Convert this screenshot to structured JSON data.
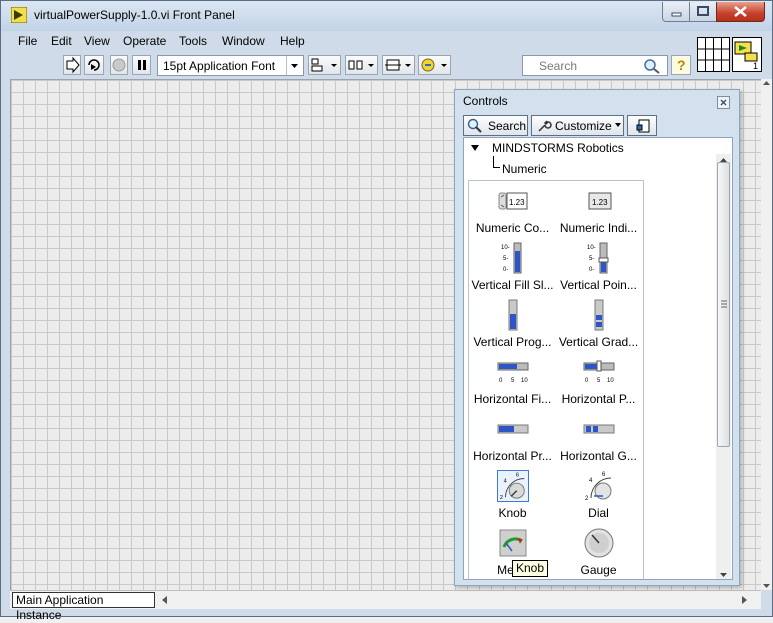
{
  "window": {
    "title": "virtualPowerSupply-1.0.vi Front Panel"
  },
  "menu": [
    "File",
    "Edit",
    "View",
    "Operate",
    "Tools",
    "Window",
    "Help"
  ],
  "toolbar": {
    "font": "15pt Application Font",
    "search_placeholder": "Search",
    "help": "?"
  },
  "status": {
    "instance": "Main Application Instance"
  },
  "palette": {
    "title": "Controls",
    "search_label": "Search",
    "customize_label": "Customize",
    "tree_root": "MINDSTORMS Robotics",
    "tree_child": "Numeric",
    "items": [
      {
        "label": "Numeric Co...",
        "icon": "numeric-control-icon"
      },
      {
        "label": "Numeric Indi...",
        "icon": "numeric-indicator-icon"
      },
      {
        "label": "Vertical Fill Sl...",
        "icon": "vertical-fill-slide-icon"
      },
      {
        "label": "Vertical Poin...",
        "icon": "vertical-pointer-slide-icon"
      },
      {
        "label": "Vertical Prog...",
        "icon": "vertical-progress-bar-icon"
      },
      {
        "label": "Vertical Grad...",
        "icon": "vertical-graduated-bar-icon"
      },
      {
        "label": "Horizontal Fi...",
        "icon": "horizontal-fill-slide-icon"
      },
      {
        "label": "Horizontal P...",
        "icon": "horizontal-pointer-slide-icon"
      },
      {
        "label": "Horizontal Pr...",
        "icon": "horizontal-progress-bar-icon"
      },
      {
        "label": "Horizontal G...",
        "icon": "horizontal-graduated-bar-icon"
      },
      {
        "label": "Knob",
        "icon": "knob-icon"
      },
      {
        "label": "Dial",
        "icon": "dial-icon"
      },
      {
        "label": "Meter",
        "icon": "meter-icon"
      },
      {
        "label": "Gauge",
        "icon": "gauge-icon"
      }
    ],
    "icon_text": {
      "numeric": "1.23",
      "scale_v": [
        "10-",
        "5-",
        "0-"
      ],
      "scale_h": [
        "0",
        "5",
        "10"
      ],
      "scale_knob": [
        "4",
        "6",
        "2"
      ]
    },
    "tooltip": "Knob"
  }
}
